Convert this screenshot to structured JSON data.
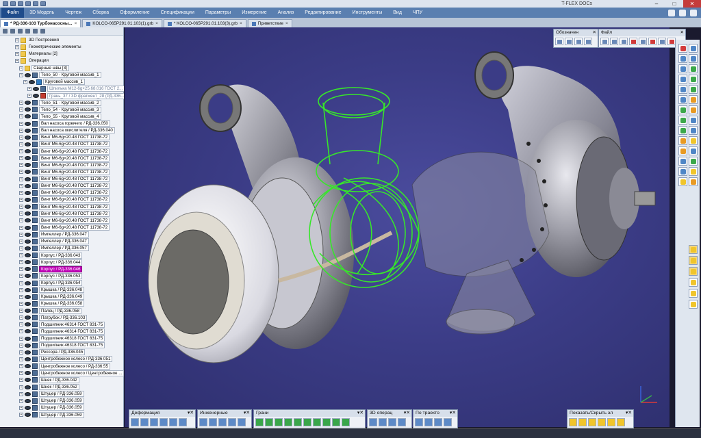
{
  "app": {
    "title": "T-FLEX DOCs"
  },
  "menu": [
    "Файл",
    "3D Модель",
    "Чертеж",
    "Сборка",
    "Оформление",
    "Спецификации",
    "Параметры",
    "Измерение",
    "Анализ",
    "Редактирование",
    "Инструменты",
    "Вид",
    "ЧПУ"
  ],
  "tabs": [
    {
      "label": "* РД-336-103 Турбонасосны...",
      "active": true
    },
    {
      "label": "KOLCO-065P291.01.103(1).grb",
      "active": false
    },
    {
      "label": "* KOLCO-065P291.01.103(3).grb",
      "active": false
    },
    {
      "label": "Приветствие",
      "active": false
    }
  ],
  "tree": [
    {
      "label": "3D Построения",
      "icon": "folder",
      "indent": 0
    },
    {
      "label": "Геометрические элементы",
      "icon": "folder",
      "indent": 0
    },
    {
      "label": "Материалы [2]",
      "icon": "folder",
      "indent": 0
    },
    {
      "label": "Операции",
      "icon": "folder",
      "indent": 0
    },
    {
      "label": "Сварные швы [3]",
      "icon": "folder",
      "indent": 1
    },
    {
      "label": "Тело_50 - Круговой массив_1",
      "icon": "body",
      "indent": 1
    },
    {
      "label": "Круговой массив_1",
      "icon": "op",
      "indent": 2
    },
    {
      "label": "Шпилька М12-6g×25.68.016 ГОСТ 2...",
      "icon": "body",
      "indent": 3,
      "state": "faded"
    },
    {
      "label": "Грань_37 / 3D фрагмент_28 (РД-336...",
      "icon": "red",
      "indent": 3,
      "state": "faded"
    },
    {
      "label": "Тело_51 - Круговой массив_2",
      "icon": "body",
      "indent": 1
    },
    {
      "label": "Тело_54 - Круговой массив_3",
      "icon": "body",
      "indent": 1
    },
    {
      "label": "Тело_55 - Круговой массив_4",
      "icon": "body",
      "indent": 1
    },
    {
      "label": "Вал насоса горючего / РД-336.050",
      "icon": "body",
      "indent": 1
    },
    {
      "label": "Вал насоса окислителя / РД-336.040",
      "icon": "body",
      "indent": 1
    },
    {
      "label": "Винт М6-6g×20.48 ГОСТ 11738-72",
      "icon": "body",
      "indent": 1
    },
    {
      "label": "Винт М6-6g×20.48 ГОСТ 11738-72",
      "icon": "body",
      "indent": 1
    },
    {
      "label": "Винт М6-6g×20.48 ГОСТ 11738-72",
      "icon": "body",
      "indent": 1
    },
    {
      "label": "Винт М6-6g×20.48 ГОСТ 11738-72",
      "icon": "body",
      "indent": 1
    },
    {
      "label": "Винт М6-6g×20.48 ГОСТ 11738-72",
      "icon": "body",
      "indent": 1
    },
    {
      "label": "Винт М6-6g×20.48 ГОСТ 11738-72",
      "icon": "body",
      "indent": 1
    },
    {
      "label": "Винт М6-6g×20.48 ГОСТ 11738-72",
      "icon": "body",
      "indent": 1
    },
    {
      "label": "Винт М6-6g×20.48 ГОСТ 11738-72",
      "icon": "body",
      "indent": 1
    },
    {
      "label": "Винт М6-6g×20.48 ГОСТ 11738-72",
      "icon": "body",
      "indent": 1
    },
    {
      "label": "Винт М6-6g×20.48 ГОСТ 11738-72",
      "icon": "body",
      "indent": 1
    },
    {
      "label": "Винт М6-6g×20.48 ГОСТ 11738-72",
      "icon": "body",
      "indent": 1
    },
    {
      "label": "Винт М6-6g×20.48 ГОСТ 11738-72",
      "icon": "body",
      "indent": 1
    },
    {
      "label": "Винт М6-6g×20.48 ГОСТ 11738-72",
      "icon": "body",
      "indent": 1
    },
    {
      "label": "Винт М6-6g×20.48 ГОСТ 11738-72",
      "icon": "body",
      "indent": 1
    },
    {
      "label": "Импеллер / РД-336.047",
      "icon": "body",
      "indent": 1
    },
    {
      "label": "Импеллер / РД-336.047",
      "icon": "body",
      "indent": 1
    },
    {
      "label": "Импеллер / РД-336.057",
      "icon": "body",
      "indent": 1
    },
    {
      "label": "Корпус / РД-336.043",
      "icon": "body",
      "indent": 1
    },
    {
      "label": "Корпус / РД-336.044",
      "icon": "body",
      "indent": 1
    },
    {
      "label": "Корпус / РД-336.046",
      "icon": "body",
      "indent": 1,
      "state": "selected"
    },
    {
      "label": "Корпус / РД-336.053",
      "icon": "body",
      "indent": 1
    },
    {
      "label": "Корпус / РД-336.054",
      "icon": "body",
      "indent": 1
    },
    {
      "label": "Крышка / РД-336.048",
      "icon": "body",
      "indent": 1
    },
    {
      "label": "Крышка / РД-336.049",
      "icon": "body",
      "indent": 1
    },
    {
      "label": "Крышка / РД-336.058",
      "icon": "body",
      "indent": 1
    },
    {
      "label": "Палец / РД-336.058",
      "icon": "body",
      "indent": 1
    },
    {
      "label": "Патрубок / РД-336.103",
      "icon": "body",
      "indent": 1
    },
    {
      "label": "Подшипник 46314 ГОСТ 831-75",
      "icon": "body",
      "indent": 1
    },
    {
      "label": "Подшипник 46314 ГОСТ 831-75",
      "icon": "body",
      "indent": 1
    },
    {
      "label": "Подшипник 46318 ГОСТ 831-75",
      "icon": "body",
      "indent": 1
    },
    {
      "label": "Подшипник 46318 ГОСТ 831-75",
      "icon": "body",
      "indent": 1
    },
    {
      "label": "Рессора / РД-336.045",
      "icon": "body",
      "indent": 1
    },
    {
      "label": "Центробежное колесо / РД-336.051",
      "icon": "body",
      "indent": 1
    },
    {
      "label": "Центробежное колесо / РД-336.55",
      "icon": "body",
      "indent": 1
    },
    {
      "label": "Центробежное колесо / Центробежное ...",
      "icon": "body",
      "indent": 1
    },
    {
      "label": "Шнек / РД-336.042",
      "icon": "body",
      "indent": 1
    },
    {
      "label": "Шнек / РД-336.052",
      "icon": "body",
      "indent": 1
    },
    {
      "label": "Штуцер / РД-336.059",
      "icon": "body",
      "indent": 1
    },
    {
      "label": "Штуцер / РД-336.059",
      "icon": "body",
      "indent": 1
    },
    {
      "label": "Штуцер / РД-336.059",
      "icon": "body",
      "indent": 1
    },
    {
      "label": "Штуцер / РД-336.059",
      "icon": "body",
      "indent": 1
    }
  ],
  "toptool": {
    "designations": "Обозначен",
    "file": "Файл"
  },
  "bottom_toolbars": [
    "Деформация",
    "Инженерные",
    "Грани",
    "3D операц",
    "По траекто",
    "Показать/Скрыть эл"
  ],
  "colors": {
    "accent": "#5a7fb0",
    "selection": "#c100b7",
    "highlight_wireframe": "#37e62a",
    "viewport_bg": "#3b3c86"
  }
}
